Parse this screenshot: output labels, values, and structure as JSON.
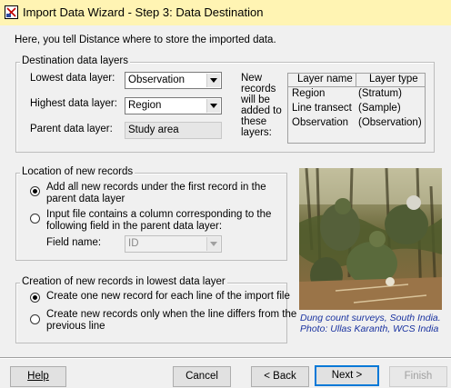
{
  "window": {
    "title": "Import Data Wizard - Step 3: Data Destination",
    "intro": "Here, you tell Distance where to store the imported data."
  },
  "data_layers": {
    "legend": "Destination data layers",
    "lowest_label": "Lowest data layer:",
    "lowest_value": "Observation",
    "highest_label": "Highest data layer:",
    "highest_value": "Region",
    "parent_label": "Parent data layer:",
    "parent_value": "Study area",
    "note_lines": [
      "New",
      "records",
      "will be",
      "added to",
      "these",
      "layers:"
    ],
    "table": {
      "headers": [
        "Layer name",
        "Layer type"
      ],
      "rows": [
        [
          "Region",
          "(Stratum)"
        ],
        [
          "Line transect",
          "(Sample)"
        ],
        [
          "Observation",
          "(Observation)"
        ]
      ]
    }
  },
  "location": {
    "legend": "Location of new records",
    "option1_lines": [
      "Add all new records under the first record in the",
      "parent data layer"
    ],
    "option2_lines": [
      "Input file contains a column corresponding to the",
      "following field in the parent data layer:"
    ],
    "field_label": "Field name:",
    "field_value": "ID",
    "selected": 1
  },
  "creation": {
    "legend": "Creation of new records in lowest data layer",
    "option1": "Create one new record for each line of the import file",
    "option2_lines": [
      "Create new records only when the line differs from the",
      "previous line"
    ],
    "selected": 1
  },
  "photo": {
    "caption_lines": [
      "Dung count surveys, South India.",
      "Photo: Ullas Karanth, WCS India"
    ]
  },
  "buttons": {
    "help": "Help",
    "cancel": "Cancel",
    "back": "< Back",
    "next": "Next >",
    "finish": "Finish"
  },
  "colors": {
    "titlebar": "#fff4b3",
    "caption": "#1a33a0",
    "default_button_border": "#0078d7"
  }
}
